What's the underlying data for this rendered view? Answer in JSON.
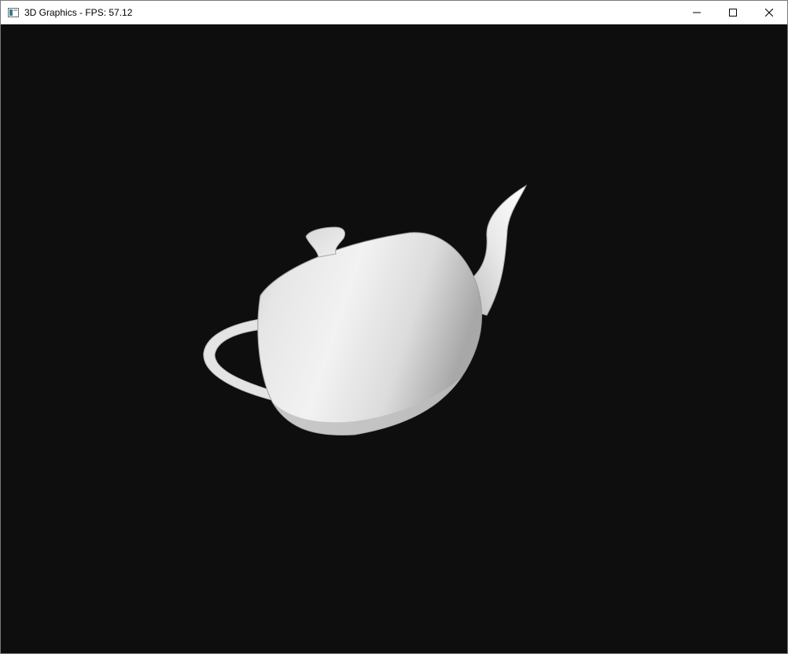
{
  "window": {
    "title": "3D Graphics - FPS: 57.12",
    "icon": "app-window-icon"
  },
  "controls": {
    "minimize_icon": "minimize-icon",
    "maximize_icon": "maximize-icon",
    "close_icon": "close-icon"
  },
  "viewport": {
    "background": "#0e0e0e",
    "object": "teapot-render"
  }
}
